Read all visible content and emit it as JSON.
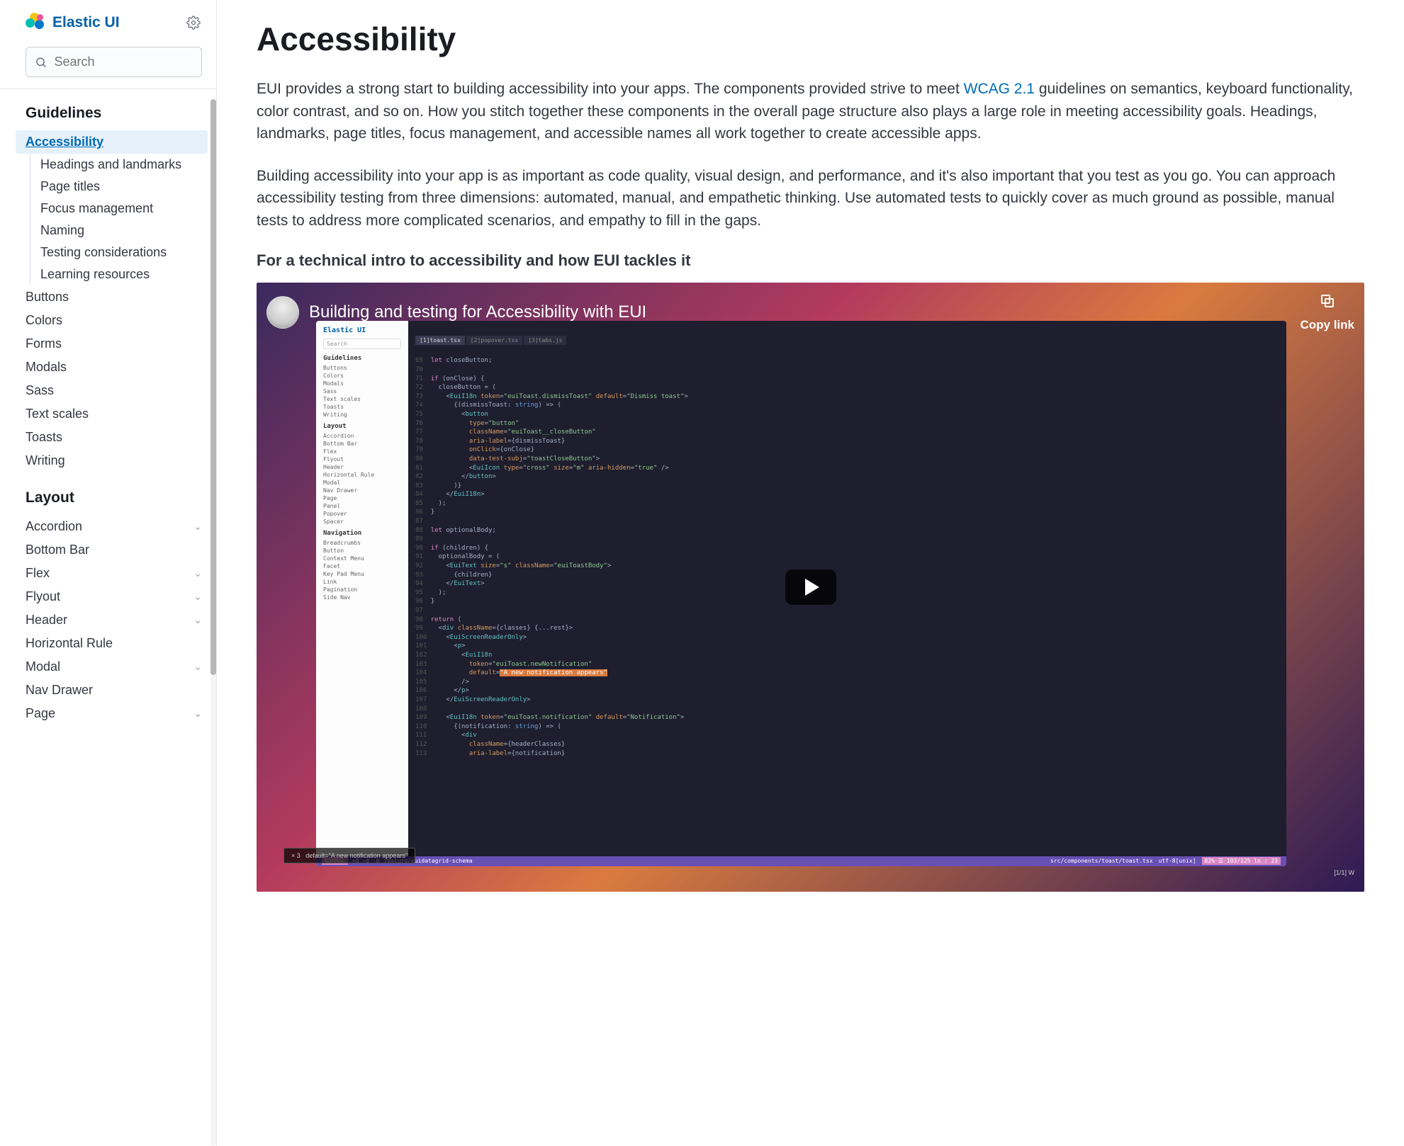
{
  "brand": {
    "name": "Elastic UI"
  },
  "search": {
    "placeholder": "Search"
  },
  "nav": {
    "guidelines": {
      "heading": "Guidelines",
      "active": "Accessibility",
      "subitems": [
        "Headings and landmarks",
        "Page titles",
        "Focus management",
        "Naming",
        "Testing considerations",
        "Learning resources"
      ],
      "items": [
        "Buttons",
        "Colors",
        "Forms",
        "Modals",
        "Sass",
        "Text scales",
        "Toasts",
        "Writing"
      ]
    },
    "layout": {
      "heading": "Layout",
      "items": [
        {
          "label": "Accordion",
          "expandable": true
        },
        {
          "label": "Bottom Bar",
          "expandable": false
        },
        {
          "label": "Flex",
          "expandable": true
        },
        {
          "label": "Flyout",
          "expandable": true
        },
        {
          "label": "Header",
          "expandable": true
        },
        {
          "label": "Horizontal Rule",
          "expandable": false
        },
        {
          "label": "Modal",
          "expandable": true
        },
        {
          "label": "Nav Drawer",
          "expandable": false
        },
        {
          "label": "Page",
          "expandable": true
        }
      ]
    }
  },
  "page": {
    "title": "Accessibility",
    "para1_a": "EUI provides a strong start to building accessibility into your apps. The components provided strive to meet ",
    "para1_link": "WCAG 2.1",
    "para1_b": " guidelines on semantics, keyboard functionality, color contrast, and so on. How you stitch together these components in the overall page structure also plays a large role in meeting accessibility goals. Headings, landmarks, page titles, focus management, and accessible names all work together to create accessible apps.",
    "para2": "Building accessibility into your app is as important as code quality, visual design, and performance, and it's also important that you test as you go. You can approach accessibility testing from three dimensions: automated, manual, and empathetic thinking. Use automated tests to quickly cover as much ground as possible, manual tests to address more complicated scenarios, and empathy to fill in the gaps.",
    "subhead": "For a technical intro to accessibility and how EUI tackles it",
    "video": {
      "title": "Building and testing for Accessibility with EUI",
      "copy_label": "Copy link",
      "notif": "default=\"A new notification appears\"",
      "notif_badge": "× 3",
      "status_branch": "feature/euidatagrid-schema",
      "status_file": "src/components/toast/toast.tsx",
      "status_enc": "utf-8[unix]",
      "status_pos": "82% ☰ 103/125 ln : 23",
      "status_mode": "[1/1] W",
      "tab_active": "[1]toast.tsx",
      "tab2": "[2]popover.tsx",
      "tab3": "[3]tabs.js",
      "mini": {
        "brand": "Elastic UI",
        "search": "Search",
        "guidelines": "Guidelines",
        "g_items": [
          "Buttons",
          "Colors",
          "Modals",
          "Sass",
          "Text scales",
          "Toasts",
          "Writing"
        ],
        "layout": "Layout",
        "l_items": [
          "Accordion",
          "Bottom Bar",
          "Flex",
          "Flyout",
          "Header",
          "Horizontal Rule",
          "Modal",
          "Nav Drawer",
          "Page",
          "Panel",
          "Popover",
          "Spacer"
        ],
        "navigation": "Navigation",
        "n_items": [
          "Breadcrumbs",
          "Button",
          "Context Menu",
          "Facet",
          "Key Pad Menu",
          "Link",
          "Pagination",
          "Side Nav"
        ]
      }
    }
  }
}
